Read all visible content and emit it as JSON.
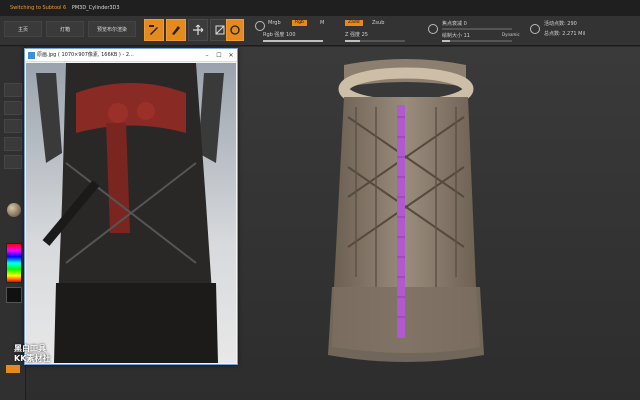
{
  "titlebar": {
    "status": "Switching to Subtool 6",
    "tool_name": "PM3D_Cylinder3D3"
  },
  "menu": {
    "home": "主页",
    "lightbox": "灯箱",
    "preview": "预览布尔渲染"
  },
  "shelf": {
    "edit_label": "Edit",
    "draw_label": "Draw",
    "mrgb_label": "Mrgb",
    "rgb_label": "Rgb",
    "m_label": "M",
    "zadd_label": "Zadd",
    "zsub_label": "Zsub",
    "rgb_intensity": "Rgb 强度 100",
    "z_intensity": "Z 强度 25",
    "focal_shift": "焦点衰减 0",
    "draw_size": "绘制大小 11",
    "dynamic_label": "Dynamic",
    "active_points": "活动点数: 290",
    "total_points": "总点数: 2.271 Mil"
  },
  "refwin": {
    "title": "原画.jpg ( 1070×907像素, 166KB ) - 2..."
  },
  "watermark": {
    "line1": "黑白工具",
    "line2": "KK素材社"
  },
  "colors": {
    "accent": "#e58a1e",
    "window_border": "#7aa0d8"
  },
  "icons": {
    "edit": "edit-icon",
    "draw": "draw-icon",
    "move": "move-icon",
    "scale": "scale-icon",
    "rotate": "rotate-icon",
    "sphere": "sphere-brush-icon"
  }
}
